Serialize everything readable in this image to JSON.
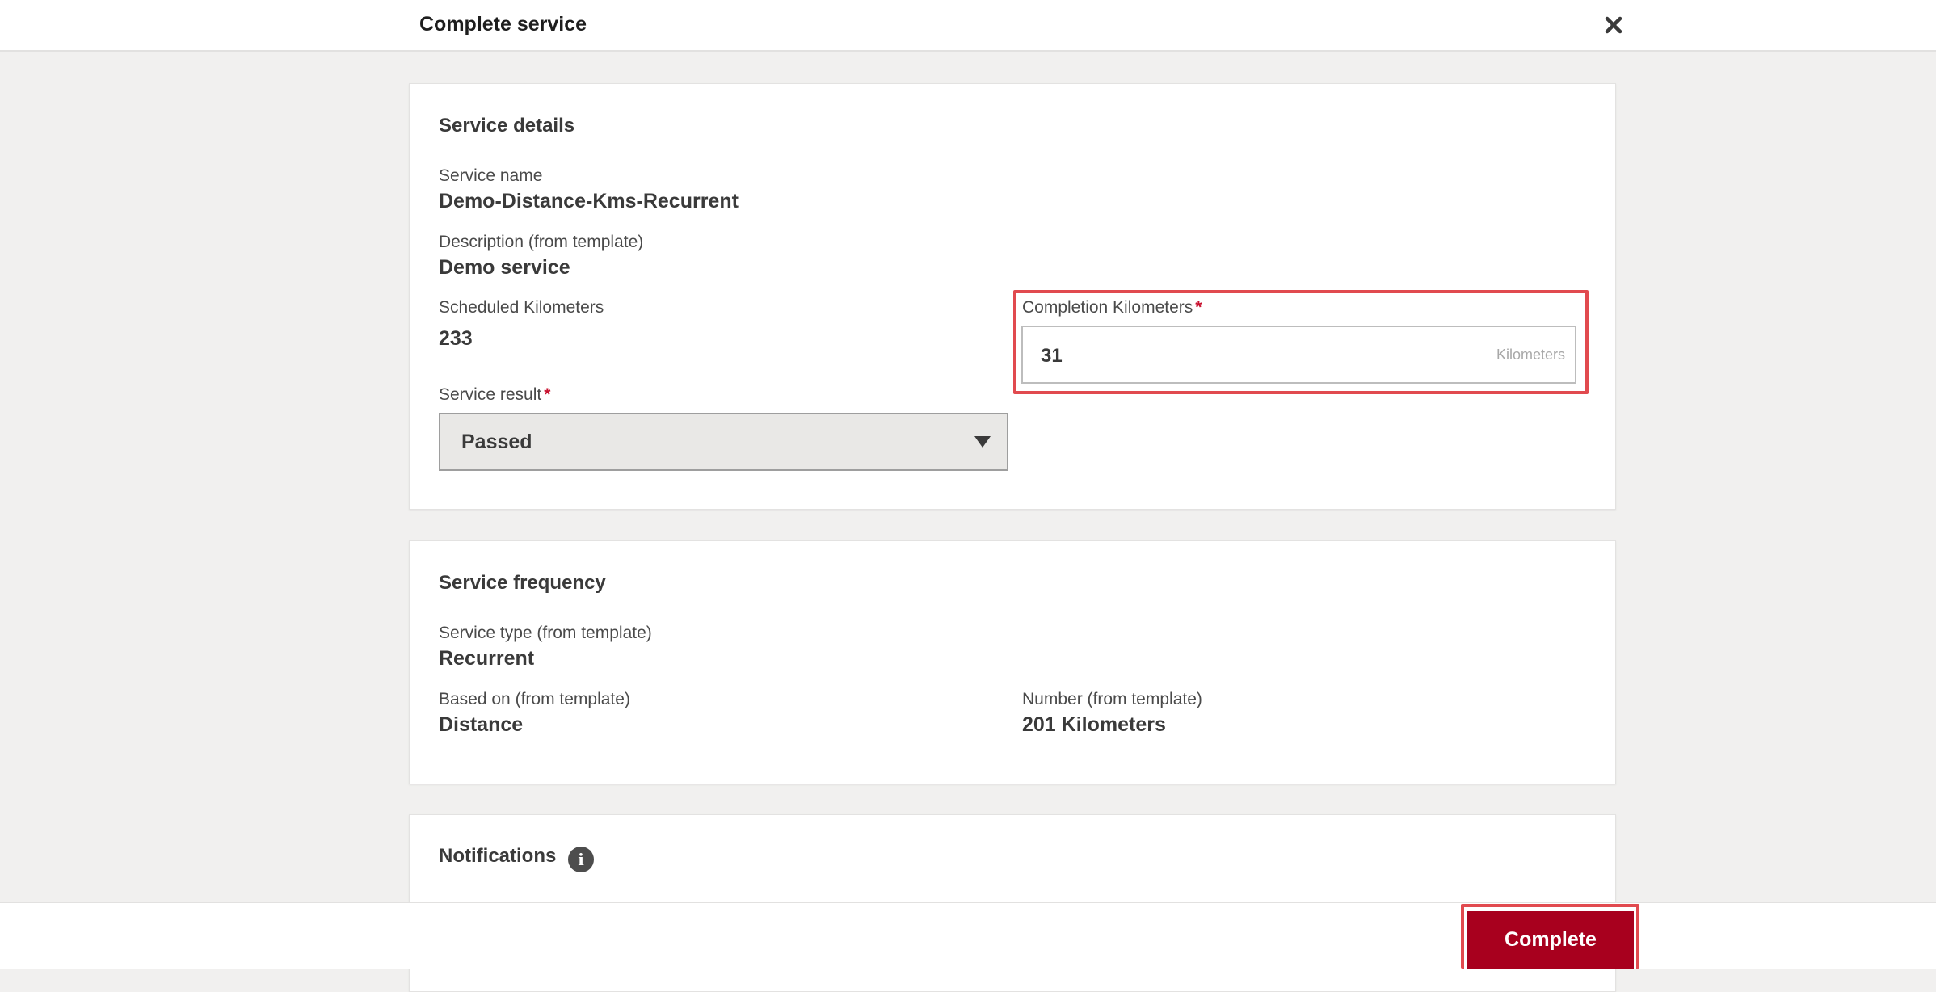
{
  "dialog": {
    "title": "Complete service",
    "close_icon": "close-icon"
  },
  "service_details": {
    "heading": "Service details",
    "service_name_label": "Service name",
    "service_name_value": "Demo-Distance-Kms-Recurrent",
    "description_label": "Description (from template)",
    "description_value": "Demo service",
    "scheduled_km_label": "Scheduled Kilometers",
    "scheduled_km_value": "233",
    "completion_km_label": "Completion Kilometers",
    "completion_km_value": "31",
    "completion_km_unit": "Kilometers",
    "service_result_label": "Service result",
    "service_result_value": "Passed",
    "required_marker": "*"
  },
  "service_frequency": {
    "heading": "Service frequency",
    "service_type_label": "Service type (from template)",
    "service_type_value": "Recurrent",
    "based_on_label": "Based on (from template)",
    "based_on_value": "Distance",
    "number_label": "Number (from template)",
    "number_value": "201 Kilometers"
  },
  "notifications": {
    "heading": "Notifications",
    "info_icon": "info-icon"
  },
  "footer": {
    "complete_label": "Complete"
  },
  "colors": {
    "accent": "#a8001e",
    "required": "#c8102e",
    "highlight": "#e14a4f",
    "background": "#f1f0ef"
  }
}
